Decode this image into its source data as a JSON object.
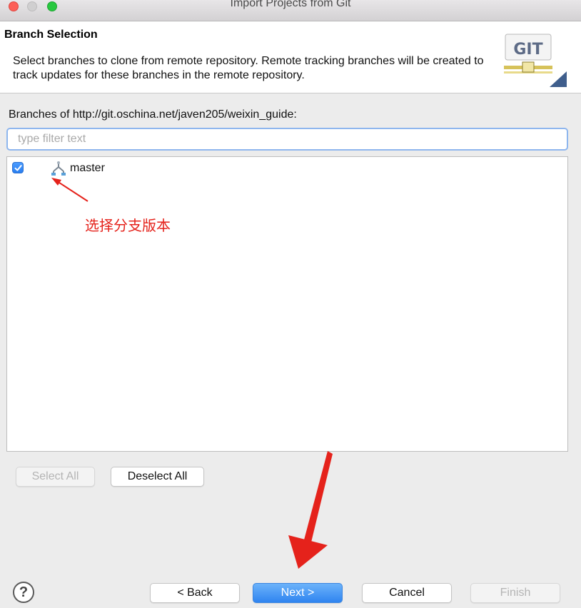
{
  "window": {
    "title": "Import Projects from Git"
  },
  "header": {
    "title": "Branch Selection",
    "description": "Select branches to clone from remote repository. Remote tracking branches will be created to track updates for these branches in the remote repository.",
    "logo_text": "GIT"
  },
  "branches": {
    "label": "Branches of http://git.oschina.net/javen205/weixin_guide:",
    "filter_placeholder": "type filter text",
    "items": [
      {
        "name": "master",
        "checked": true
      }
    ]
  },
  "annotation": {
    "text": "选择分支版本",
    "color": "#e5221b"
  },
  "selection_buttons": {
    "select_all": "Select All",
    "deselect_all": "Deselect All"
  },
  "footer": {
    "help": "?",
    "back": "< Back",
    "next": "Next >",
    "cancel": "Cancel",
    "finish": "Finish"
  },
  "colors": {
    "accent": "#2f84f0",
    "annotation": "#e5221b"
  }
}
